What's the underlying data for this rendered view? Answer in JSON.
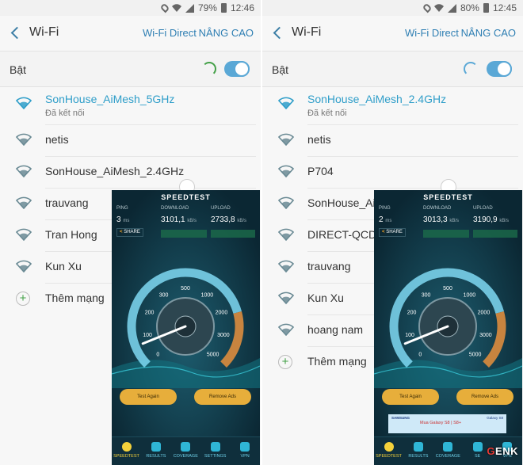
{
  "panels": [
    {
      "status": {
        "battery": "79%",
        "time": "12:46"
      },
      "header": {
        "title": "Wi-Fi",
        "wifi_direct": "Wi-Fi Direct",
        "advanced": "NÂNG CAO"
      },
      "toggle": {
        "label": "Bật",
        "on": true
      },
      "networks": [
        {
          "name": "SonHouse_AiMesh_5GHz",
          "status": "Đã kết nối",
          "connected": true
        },
        {
          "name": "netis"
        },
        {
          "name": "SonHouse_AiMesh_2.4GHz"
        },
        {
          "name": "trauvang"
        },
        {
          "name": "Tran Hong"
        },
        {
          "name": "Kun Xu"
        }
      ],
      "add_network": "Thêm mạng",
      "speedtest": {
        "logo": "SPEEDTEST",
        "ping": {
          "label": "PING",
          "value": "3",
          "unit": "ms"
        },
        "download": {
          "label": "DOWNLOAD",
          "value": "3101,1",
          "unit": "kB/s"
        },
        "upload": {
          "label": "UPLOAD",
          "value": "2733,8",
          "unit": "kB/s"
        },
        "share": "SHARE",
        "gauge_ticks": [
          "0",
          "100",
          "200",
          "300",
          "500",
          "1000",
          "2000",
          "3000",
          "5000"
        ],
        "test_again": "Test Again",
        "remove_ads": "Remove Ads",
        "nav": [
          "SPEEDTEST",
          "RESULTS",
          "COVERAGE",
          "SETTINGS",
          "VPN"
        ]
      }
    },
    {
      "status": {
        "battery": "80%",
        "time": "12:45"
      },
      "header": {
        "title": "Wi-Fi",
        "wifi_direct": "Wi-Fi Direct",
        "advanced": "NÂNG CAO"
      },
      "toggle": {
        "label": "Bật",
        "on": true
      },
      "networks": [
        {
          "name": "SonHouse_AiMesh_2.4GHz",
          "status": "Đã kết nối",
          "connected": true
        },
        {
          "name": "netis"
        },
        {
          "name": "P704"
        },
        {
          "name": "SonHouse_Ai"
        },
        {
          "name": "DIRECT-QCDE"
        },
        {
          "name": "trauvang"
        },
        {
          "name": "Kun Xu"
        },
        {
          "name": "hoang nam"
        }
      ],
      "add_network": "Thêm mạng",
      "speedtest": {
        "logo": "SPEEDTEST",
        "ping": {
          "label": "PING",
          "value": "2",
          "unit": "ms"
        },
        "download": {
          "label": "DOWNLOAD",
          "value": "3013,3",
          "unit": "kB/s"
        },
        "upload": {
          "label": "UPLOAD",
          "value": "3190,9",
          "unit": "kB/s"
        },
        "share": "SHARE",
        "gauge_ticks": [
          "0",
          "100",
          "200",
          "300",
          "500",
          "1000",
          "2000",
          "3000",
          "5000"
        ],
        "test_again": "Test Again",
        "remove_ads": "Remove Ads",
        "nav": [
          "SPEEDTEST",
          "RESULTS",
          "COVERAGE",
          "SE",
          "VPN"
        ],
        "ad": {
          "brand": "SAMSUNG",
          "text": "Mua Galaxy S8 | S8+",
          "product": "Galaxy S8"
        }
      }
    }
  ],
  "watermark": {
    "prefix": "G",
    "rest": "ENK"
  },
  "colors": {
    "accent": "#2f9ec9",
    "toggle": "#5aa8d6",
    "button": "#e7ae3b",
    "gauge_arc": "#7fd8f2",
    "upload_arc": "#c8843f"
  }
}
